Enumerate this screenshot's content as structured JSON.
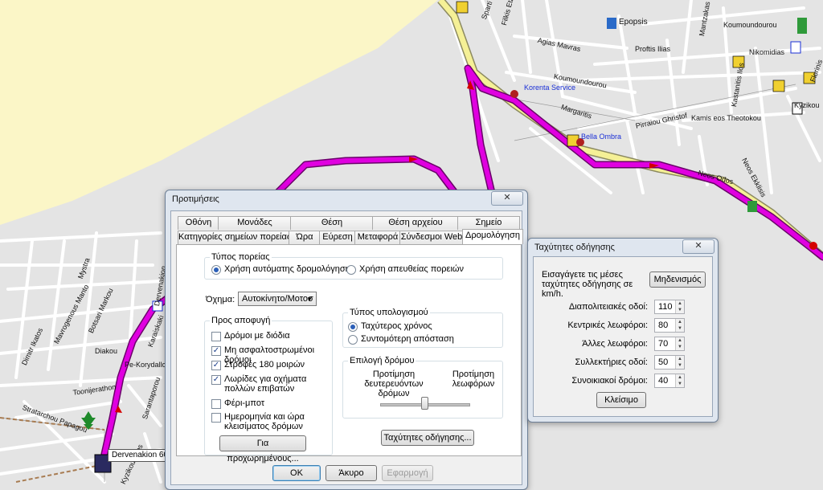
{
  "map": {
    "streets": [
      "Filkis Etairias",
      "Sparti",
      "Agias Mavras",
      "Proftis Ilias",
      "Koumoundourou",
      "Koumoundourou",
      "Margaritis",
      "Nikomidias",
      "Florinis",
      "Mantzakas",
      "Pirraiou Ghristof",
      "Kastanitis Ilos",
      "Kyzikou",
      "Kamis eos Theotokou",
      "Neos Ekklisis",
      "Neos Odos",
      "Mystra",
      "Mavrogenous Manto",
      "Dimitr Ikatos",
      "Botsari Markou",
      "Dervenakion",
      "Diakou",
      "Karaiskaki",
      "Pe-Korydallos",
      "Toonijerathon",
      "Stratarchou Papagou",
      "Sarantaporou",
      "Kyzikou Oros"
    ],
    "pois": [
      "Epopsis",
      "Korenta Service",
      "Bella Ombra"
    ],
    "location_label": "Dervenakion 60",
    "colors": {
      "route": "#e000e0",
      "route_edge": "#6a006a",
      "major_road": "#f5f096",
      "sea": "#fbf6c7",
      "street": "#ffffff"
    }
  },
  "prefs": {
    "title": "Προτιμήσεις",
    "close": "✕",
    "tabs_row1": [
      "Οθόνη",
      "Μονάδες",
      "Θέση",
      "Θέση αρχείου",
      "Σημείο"
    ],
    "tabs_row2": [
      "Κατηγορίες σημείων πορείας",
      "Ώρα",
      "Εύρεση",
      "Μεταφορά",
      "Σύνδεσμοι Web",
      "Δρομολόγηση"
    ],
    "route_type": {
      "title": "Τύπος πορείας",
      "auto": "Χρήση αυτόματης δρομολόγησης",
      "direct": "Χρήση απευθείας πορειών",
      "selected": "auto"
    },
    "vehicle": {
      "label": "Όχημα:",
      "value": "Αυτοκίνητο/Μοτοσ"
    },
    "avoid": {
      "title": "Προς αποφυγή",
      "items": [
        {
          "label": "Δρόμοι με διόδια",
          "checked": false
        },
        {
          "label": "Μη ασφαλτοστρωμένοι δρόμοι",
          "checked": true
        },
        {
          "label": "Στροφές 180 μοιρών",
          "checked": true
        },
        {
          "label": "Λωρίδες για οχήματα πολλών επιβατών",
          "checked": true
        },
        {
          "label": "Φέρι-μποτ",
          "checked": false
        },
        {
          "label": "Ημερομηνία και ώρα κλεισίματος δρόμων",
          "checked": false
        }
      ],
      "advanced": "Για προχωρημένους..."
    },
    "calc": {
      "title": "Τύπος υπολογισμού",
      "fastest": "Ταχύτερος χρόνος",
      "shortest": "Συντομότερη απόσταση",
      "selected": "fastest"
    },
    "road_sel": {
      "title": "Επιλογή δρόμου",
      "left": "Προτίμηση δευτερευόντων δρόμων",
      "right": "Προτίμηση λεωφόρων",
      "slider_fraction": 0.5
    },
    "speeds_btn": "Ταχύτητες οδήγησης...",
    "ok": "OK",
    "cancel": "Άκυρο",
    "apply": "Εφαρμογή"
  },
  "speeds": {
    "title": "Ταχύτητες οδήγησης",
    "close": "✕",
    "instruction": "Εισαγάγετε τις μέσες ταχύτητες οδήγησης σε km/h.",
    "reset": "Μηδενισμός",
    "rows": [
      {
        "label": "Διαπολιτειακές οδοί:",
        "value": "110"
      },
      {
        "label": "Κεντρικές λεωφόροι:",
        "value": "80"
      },
      {
        "label": "Άλλες λεωφόροι:",
        "value": "70"
      },
      {
        "label": "Συλλεκτήριες οδοί:",
        "value": "50"
      },
      {
        "label": "Συνοικιακοί δρόμοι:",
        "value": "40"
      }
    ],
    "close_btn": "Κλείσιμο"
  }
}
